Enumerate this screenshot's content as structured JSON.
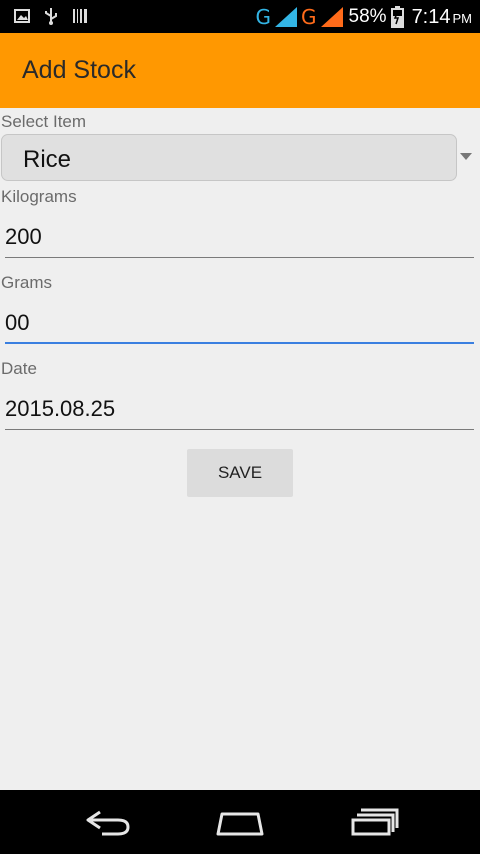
{
  "status_bar": {
    "network_1": "G",
    "network_2": "G",
    "battery": "58%",
    "time": "7:14",
    "ampm": "PM",
    "icons": [
      "gallery-icon",
      "usb-icon",
      "barcode-icon",
      "signal-icon",
      "battery-icon"
    ]
  },
  "app_bar": {
    "title": "Add Stock",
    "color": "#ff9801"
  },
  "form": {
    "select_item": {
      "label": "Select Item",
      "value": "Rice"
    },
    "kilograms": {
      "label": "Kilograms",
      "value": "200"
    },
    "grams": {
      "label": "Grams",
      "value": "00"
    },
    "date": {
      "label": "Date",
      "value": "2015.08.25"
    },
    "save_label": "SAVE"
  },
  "nav_bar": {
    "icons": [
      "back-icon",
      "home-icon",
      "recent-apps-icon"
    ]
  }
}
